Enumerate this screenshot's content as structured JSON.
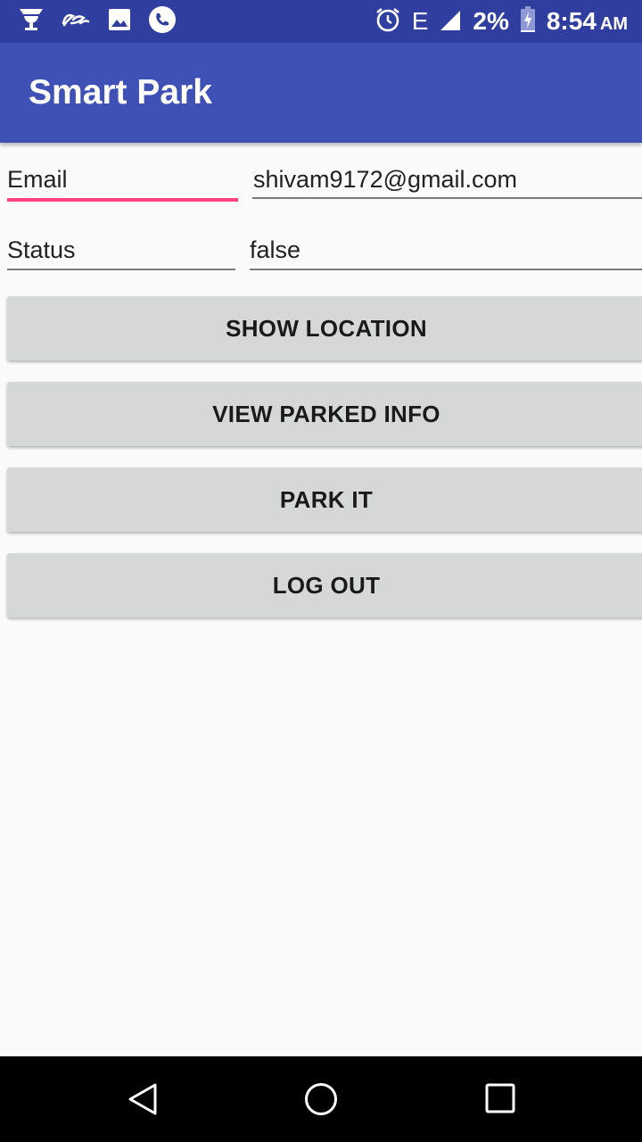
{
  "status_bar": {
    "icons_left": [
      "trophy-icon",
      "alibaba-icon",
      "image-icon",
      "phone-icon"
    ],
    "icons_right": [
      "alarm-icon",
      "signal-icon",
      "battery-charging-icon"
    ],
    "network": "E",
    "battery": "2%",
    "time": "8:54",
    "ampm": "AM"
  },
  "app_bar": {
    "title": "Smart Park"
  },
  "form": {
    "email_label": "Email",
    "email_value": "shivam9172@gmail.com",
    "status_label": "Status",
    "status_value": "false"
  },
  "buttons": {
    "show_location": "SHOW LOCATION",
    "view_parked_info": "VIEW PARKED INFO",
    "park_it": "PARK IT",
    "log_out": "LOG OUT"
  },
  "nav_bar": {
    "icons": [
      "back-icon",
      "home-icon",
      "recents-icon"
    ]
  },
  "colors": {
    "status_bar": "#303f9f",
    "primary": "#3f51b5",
    "accent": "#ff4081",
    "button": "#d6d7d7",
    "background": "#fafafa"
  }
}
